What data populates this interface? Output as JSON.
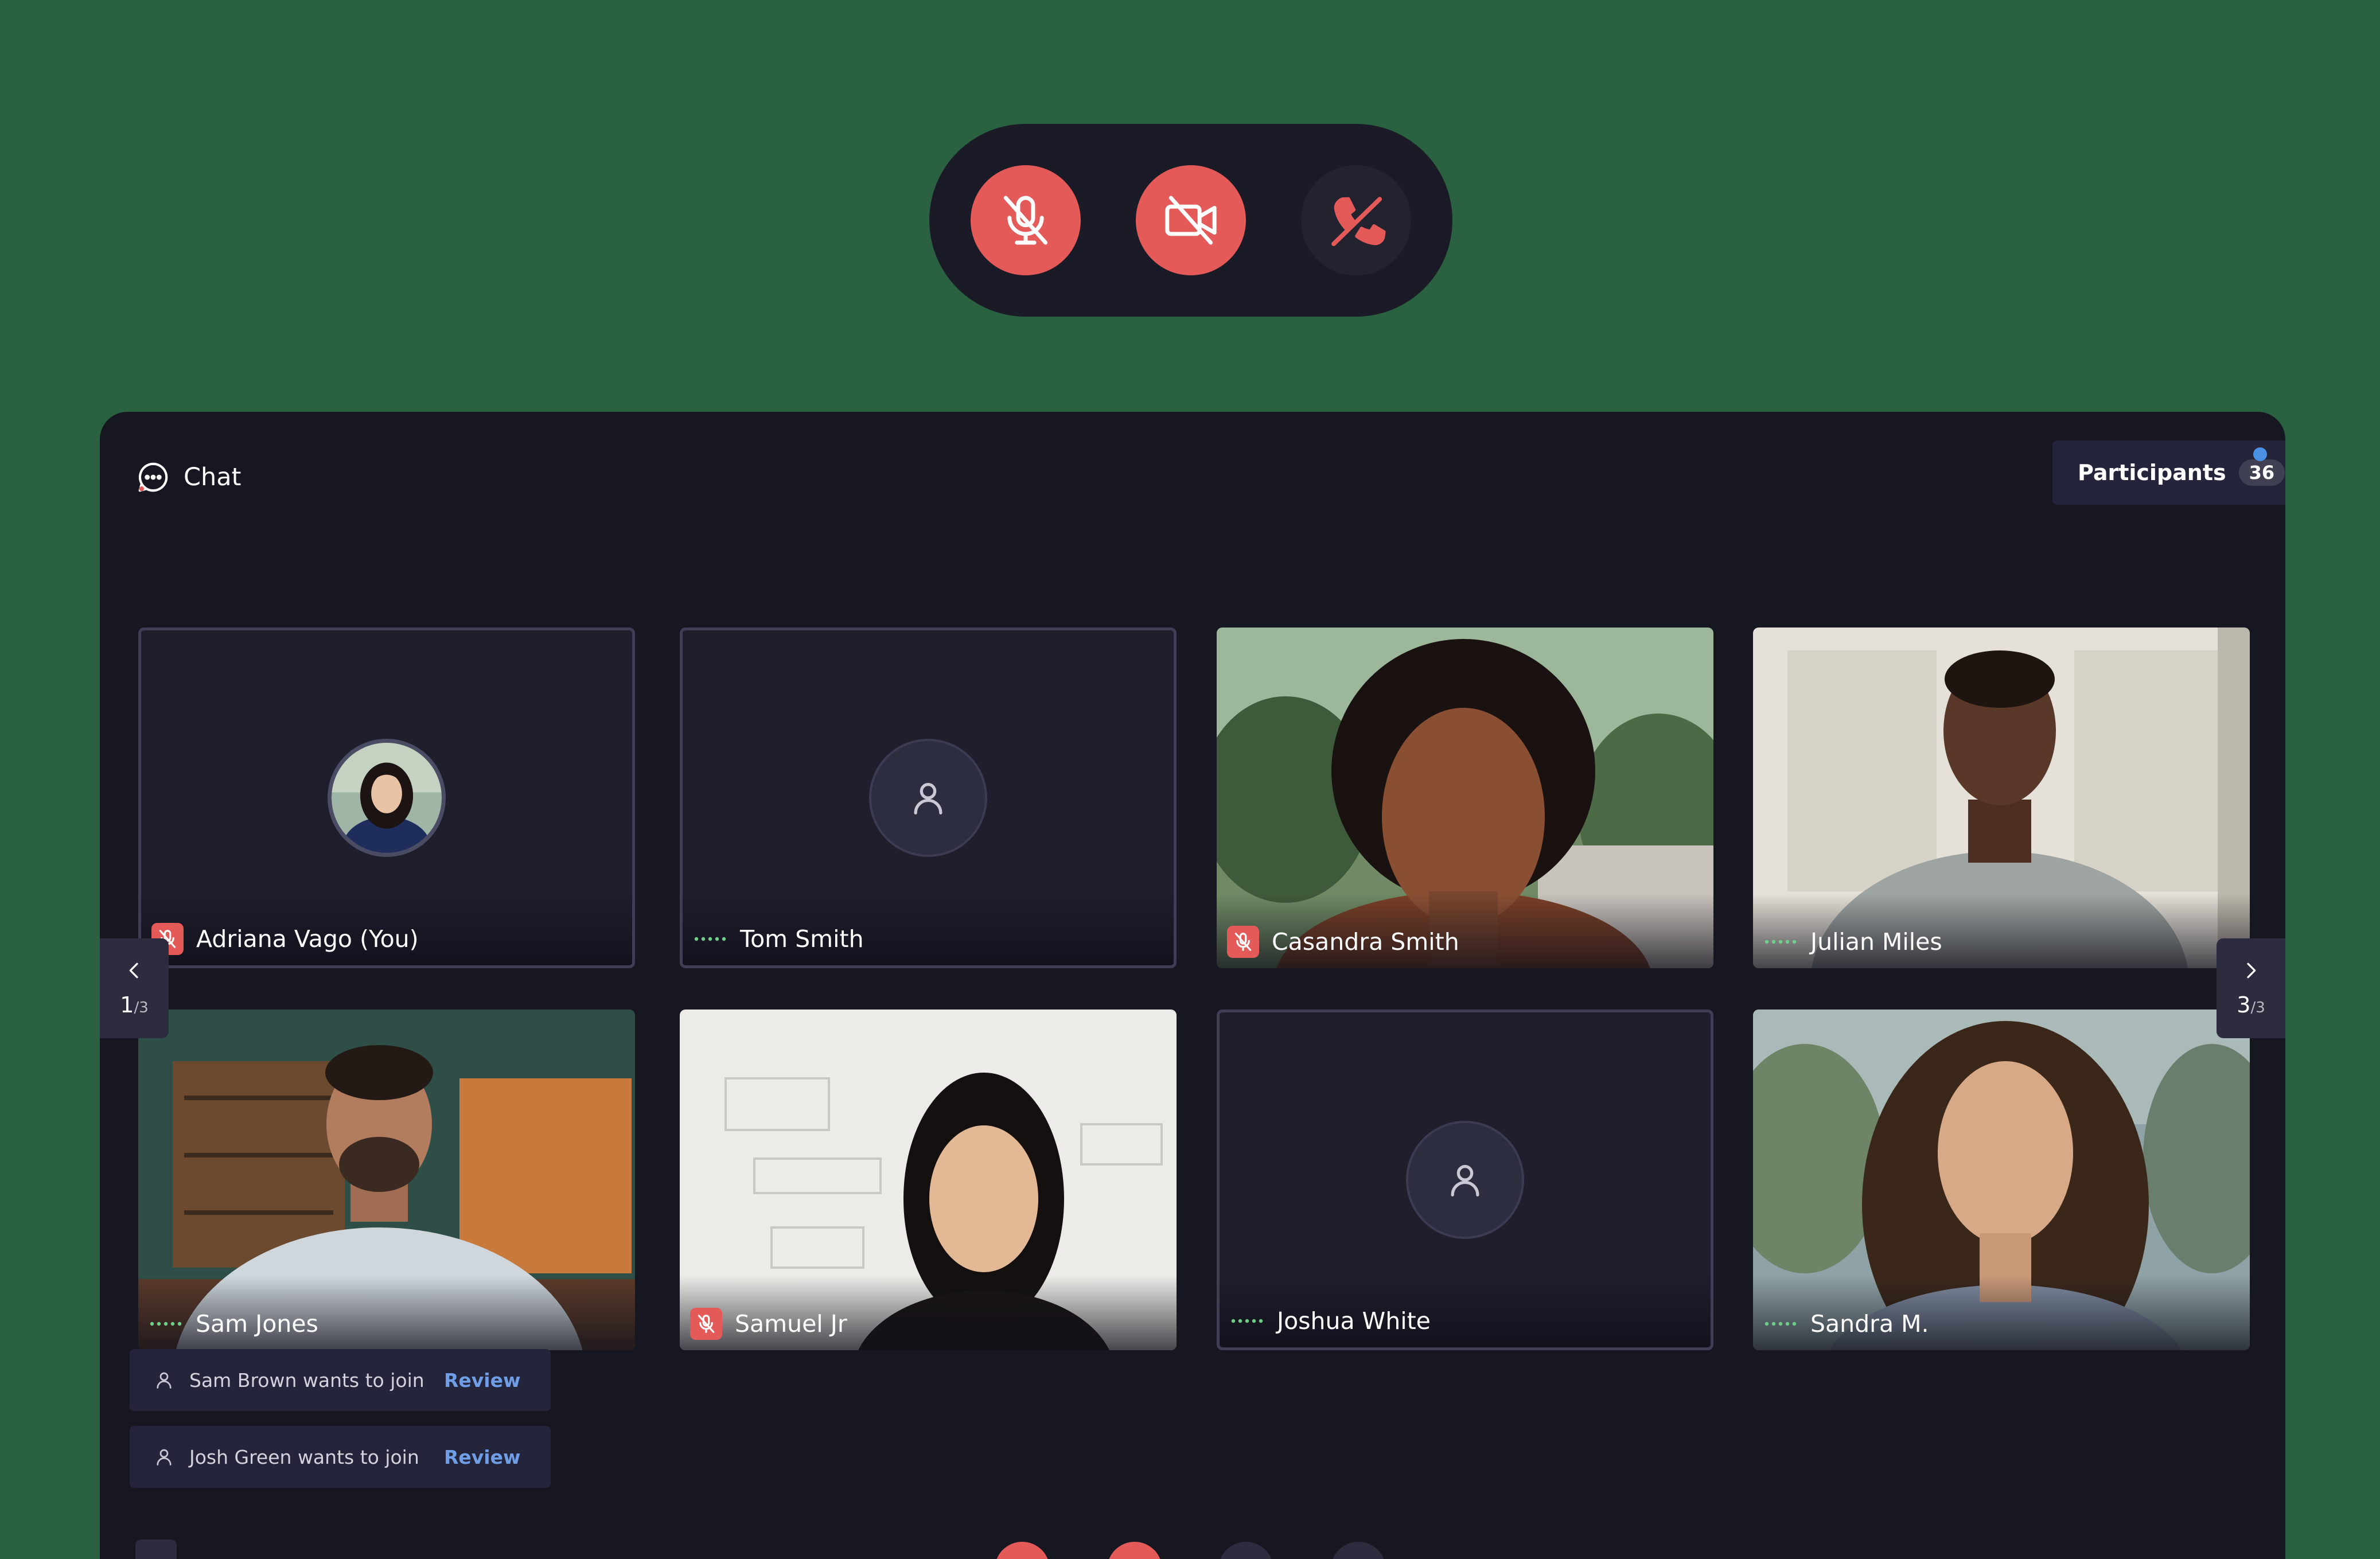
{
  "controls": {
    "mute": {
      "icon": "mic-off-icon",
      "color": "#e35a58"
    },
    "camera": {
      "icon": "video-off-icon",
      "color": "#e35a58"
    },
    "hangup": {
      "icon": "phone-off-icon",
      "color": "#e35a58"
    }
  },
  "header": {
    "chat_label": "Chat",
    "participants_label": "Participants",
    "participants_count": "36"
  },
  "tiles": [
    {
      "name": "Adriana Vago (You)",
      "status": "muted"
    },
    {
      "name": "Tom Smith",
      "status": "speaking"
    },
    {
      "name": "Casandra Smith",
      "status": "muted"
    },
    {
      "name": "Julian Miles",
      "status": "speaking"
    },
    {
      "name": "Sam Jones",
      "status": "speaking"
    },
    {
      "name": "Samuel Jr",
      "status": "muted"
    },
    {
      "name": "Joshua White",
      "status": "speaking"
    },
    {
      "name": "Sandra M.",
      "status": "speaking"
    }
  ],
  "pager_left": {
    "current": "1",
    "total": "/3"
  },
  "pager_right": {
    "current": "3",
    "total": "/3"
  },
  "join_requests": [
    {
      "text": "Sam Brown wants to join",
      "action": "Review"
    },
    {
      "text": "Josh Green wants to join",
      "action": "Review"
    }
  ],
  "colors": {
    "background": "#2a6141",
    "window": "#171721",
    "accent_red": "#e35a58",
    "link_blue": "#6f9ee6",
    "speaking_green": "#6fcf8a"
  }
}
